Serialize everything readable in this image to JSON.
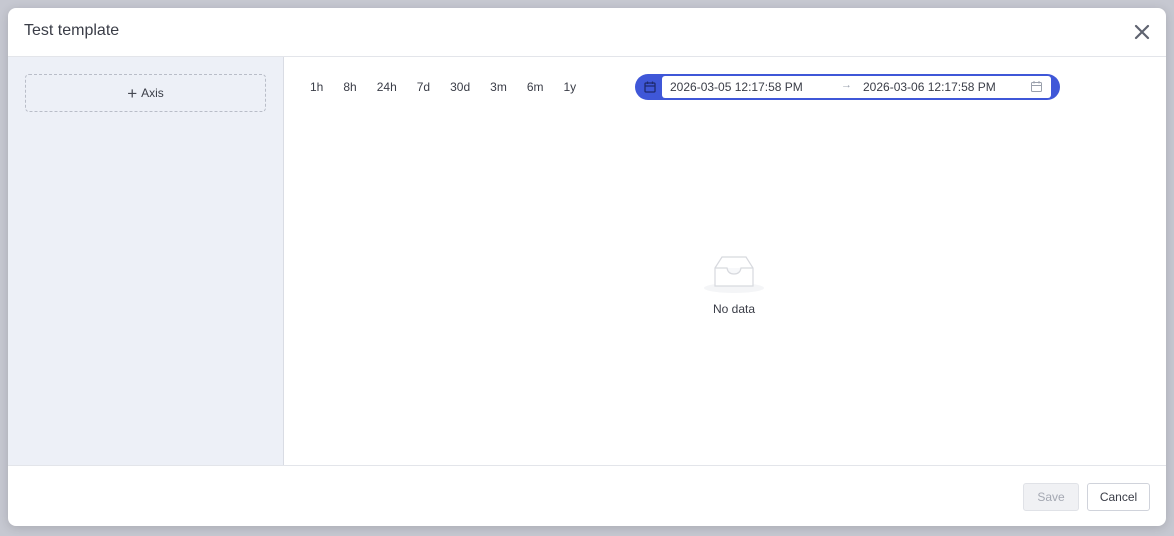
{
  "dialog": {
    "title": "Test template"
  },
  "sidebar": {
    "add_axis_label": "Axis"
  },
  "time_ranges": [
    "1h",
    "8h",
    "24h",
    "7d",
    "30d",
    "3m",
    "6m",
    "1y"
  ],
  "date_picker": {
    "start": "2026-03-05 12:17:58 PM",
    "separator": "→",
    "end": "2026-03-06 12:17:58 PM",
    "accent": "#3f57d8"
  },
  "empty_state": {
    "text": "No data"
  },
  "footer": {
    "save_label": "Save",
    "cancel_label": "Cancel"
  }
}
